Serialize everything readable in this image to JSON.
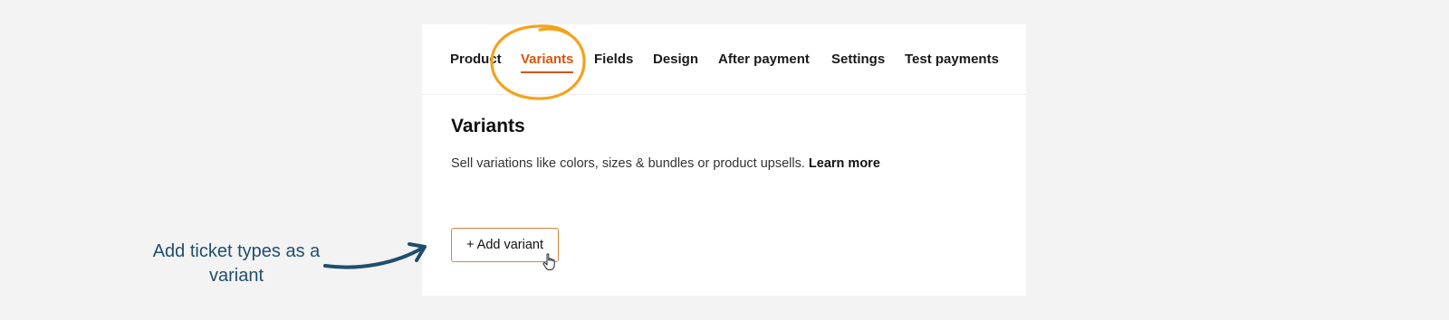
{
  "tabs": [
    {
      "label": "Product",
      "active": false
    },
    {
      "label": "Variants",
      "active": true
    },
    {
      "label": "Fields",
      "active": false
    },
    {
      "label": "Design",
      "active": false
    },
    {
      "label": "After payment",
      "active": false
    },
    {
      "label": "Settings",
      "active": false
    },
    {
      "label": "Test payments",
      "active": false
    }
  ],
  "main": {
    "title": "Variants",
    "description": "Sell variations like colors, sizes & bundles or product upsells.",
    "learn_more": "Learn more",
    "add_button": "+ Add variant"
  },
  "annotation": {
    "text": "Add ticket types as a variant"
  },
  "colors": {
    "accent": "#d3570c",
    "highlight_circle": "#f4a21c",
    "annotation": "#1f4e6e",
    "background": "#f3f3f3"
  },
  "icons": {
    "cursor": "hand-pointer-icon",
    "arrow": "curved-arrow-icon",
    "highlight": "hand-drawn-circle-icon"
  }
}
